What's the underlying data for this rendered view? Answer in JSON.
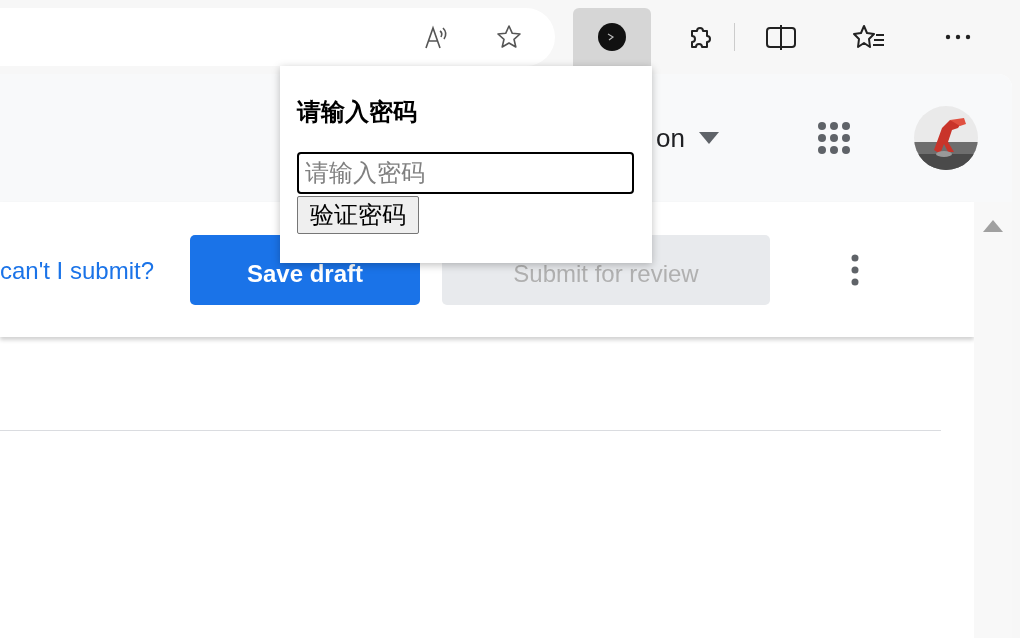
{
  "browser_toolbar": {
    "extension_button": {
      "active": true
    }
  },
  "header": {
    "account_text": "on"
  },
  "action_bar": {
    "help_link": "can't I submit?",
    "save_button": "Save draft",
    "submit_button": {
      "label": "Submit for review",
      "disabled": true
    }
  },
  "popup": {
    "title": "请输入密码",
    "password_field": {
      "placeholder": "请输入密码"
    },
    "verify_button": "验证密码"
  }
}
